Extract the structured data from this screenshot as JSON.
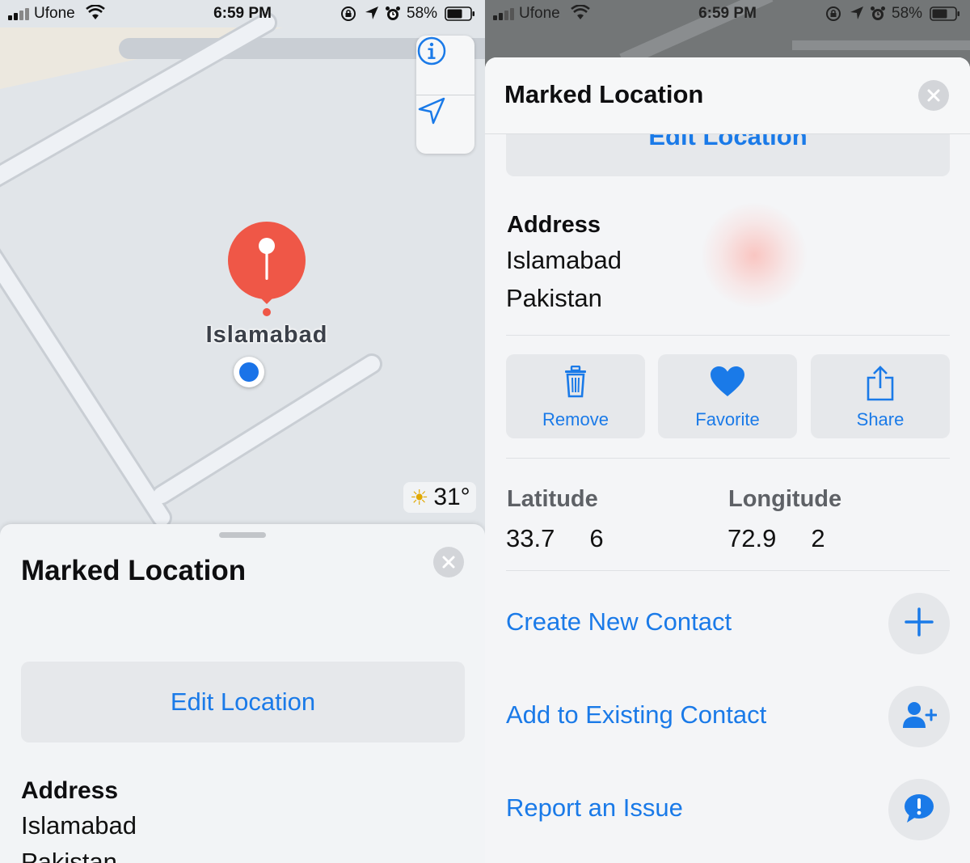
{
  "status_bar": {
    "carrier": "Ufone",
    "time": "6:59 PM",
    "battery": "58%"
  },
  "map": {
    "place_label": "Islamabad",
    "weather": "31°",
    "icons": [
      "info-icon",
      "location-arrow-icon",
      "sun-icon",
      "pin-icon"
    ]
  },
  "left_sheet": {
    "title": "Marked Location",
    "edit_label": "Edit Location",
    "address_heading": "Address",
    "address_line1": "Islamabad",
    "address_line2": "Pakistan"
  },
  "right_sheet": {
    "title": "Marked Location",
    "edit_label": "Edit Location",
    "address_heading": "Address",
    "address_line1": "Islamabad",
    "address_line2": "Pakistan",
    "actions": [
      {
        "label": "Remove",
        "icon": "trash-icon"
      },
      {
        "label": "Favorite",
        "icon": "heart-icon"
      },
      {
        "label": "Share",
        "icon": "share-icon"
      }
    ],
    "latitude_label": "Latitude",
    "latitude_value": "33.7     6",
    "longitude_label": "Longitude",
    "longitude_value": "72.9     2",
    "links": [
      {
        "label": "Create New Contact",
        "icon": "plus-icon"
      },
      {
        "label": "Add to Existing Contact",
        "icon": "add-person-icon"
      },
      {
        "label": "Report an Issue",
        "icon": "exclamation-bubble-icon"
      }
    ]
  },
  "colors": {
    "accent": "#1a7ae8",
    "pin": "#ef5747",
    "user_dot": "#1a73e8"
  }
}
